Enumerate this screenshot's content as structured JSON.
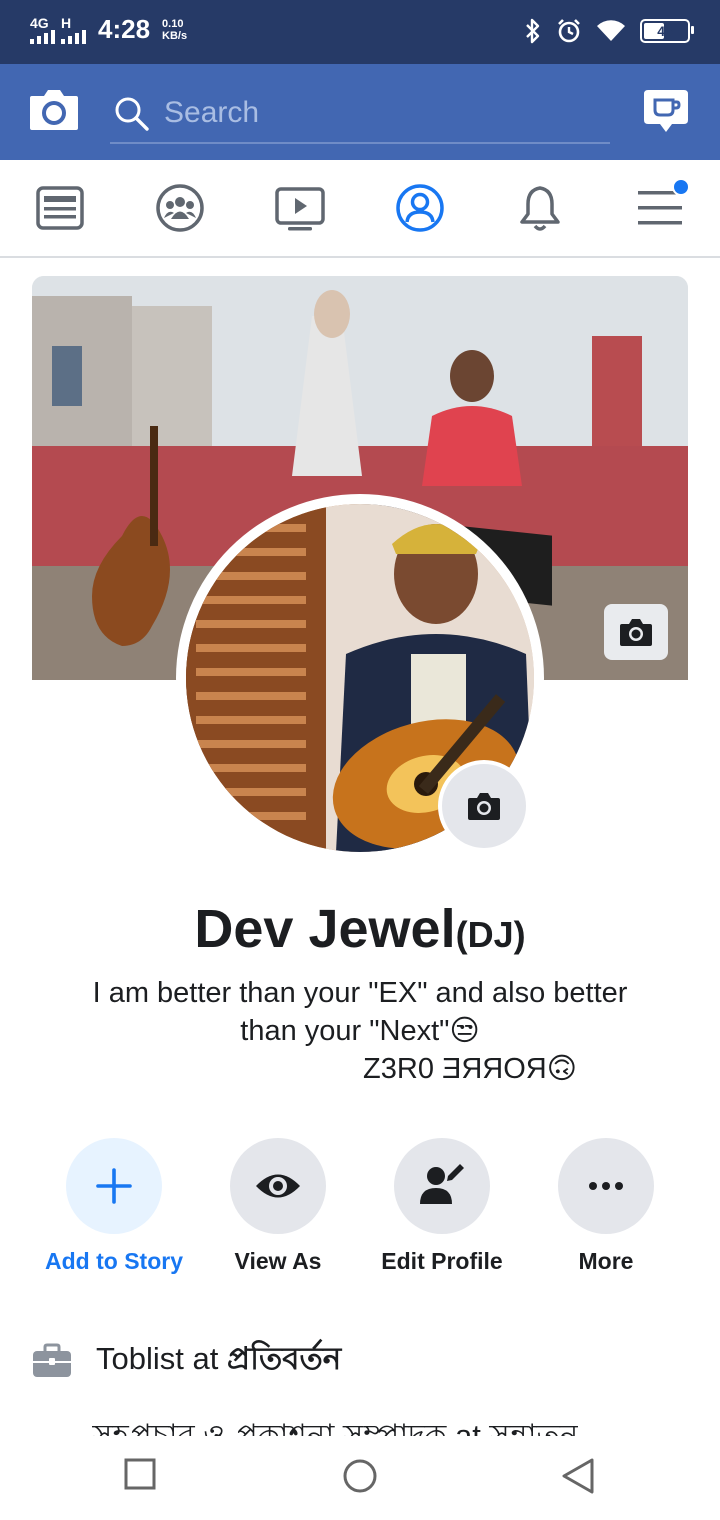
{
  "status_bar": {
    "network1": "4G",
    "network2": "H",
    "time": "4:28",
    "speed_value": "0.10",
    "speed_unit": "KB/s",
    "battery": "45"
  },
  "appbar": {
    "search_placeholder": "Search"
  },
  "profile": {
    "name": "Dev Jewel",
    "nickname": "(DJ)",
    "bio_line1": "I am better than your \"EX\" and also  better",
    "bio_line2": "than your \"Next\"😒",
    "bio_line3": "Z3R0  ƎЯЯOЯ🙃"
  },
  "actions": [
    {
      "label": "Add to Story",
      "icon": "plus-icon"
    },
    {
      "label": "View As",
      "icon": "eye-icon"
    },
    {
      "label": "Edit Profile",
      "icon": "edit-profile-icon"
    },
    {
      "label": "More",
      "icon": "more-icon"
    }
  ],
  "work": {
    "line1_prefix": "Toblist at ",
    "line1_org": "প্রতিবর্তন",
    "line2": "সহপ্রচার ও প্রকাশনা সম্পাদক at সন্নাতন"
  },
  "colors": {
    "status_bar": "#263a67",
    "app_bar": "#4267b2",
    "accent": "#1877f2"
  }
}
